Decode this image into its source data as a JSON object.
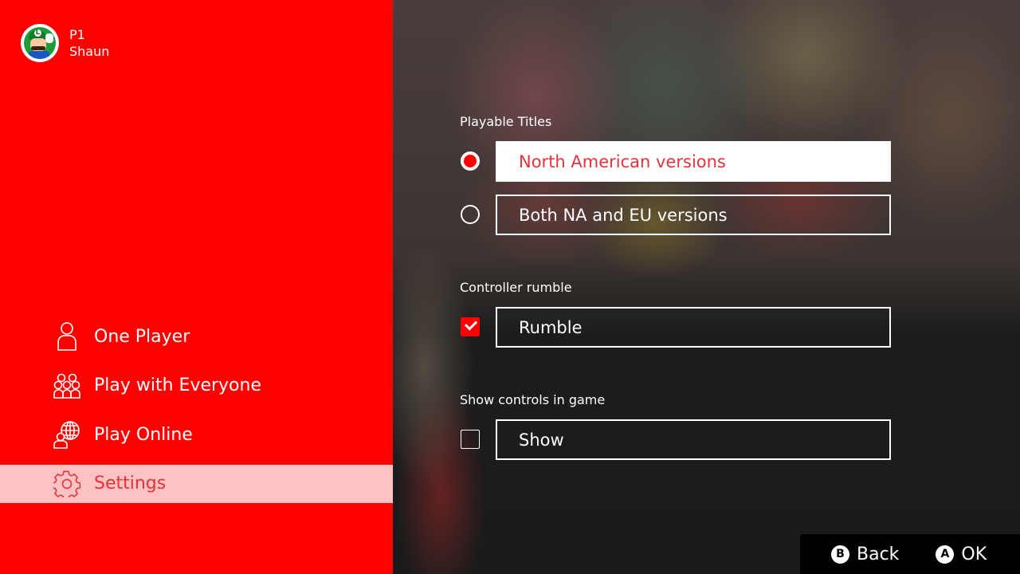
{
  "profile": {
    "player_slot": "P1",
    "username": "Shaun",
    "avatar": "luigi-avatar"
  },
  "sidebar": {
    "items": [
      {
        "label": "One Player",
        "icon": "person-icon",
        "active": false
      },
      {
        "label": "Play with Everyone",
        "icon": "group-icon",
        "active": false
      },
      {
        "label": "Play Online",
        "icon": "globe-person-icon",
        "active": false
      },
      {
        "label": "Settings",
        "icon": "gear-icon",
        "active": true
      }
    ]
  },
  "settings": {
    "playable_titles": {
      "label": "Playable Titles",
      "options": [
        {
          "label": "North American versions",
          "selected": true
        },
        {
          "label": "Both NA and EU versions",
          "selected": false
        }
      ]
    },
    "controller_rumble": {
      "label": "Controller rumble",
      "option": {
        "label": "Rumble",
        "checked": true
      }
    },
    "show_controls": {
      "label": "Show controls in game",
      "option": {
        "label": "Show",
        "checked": false
      }
    }
  },
  "footer": {
    "back": {
      "glyph": "B",
      "label": "Back"
    },
    "ok": {
      "glyph": "A",
      "label": "OK"
    }
  },
  "colors": {
    "accent": "#ff0000",
    "active_item_bg": "#ffc2c2",
    "selected_text": "#e2333c"
  }
}
